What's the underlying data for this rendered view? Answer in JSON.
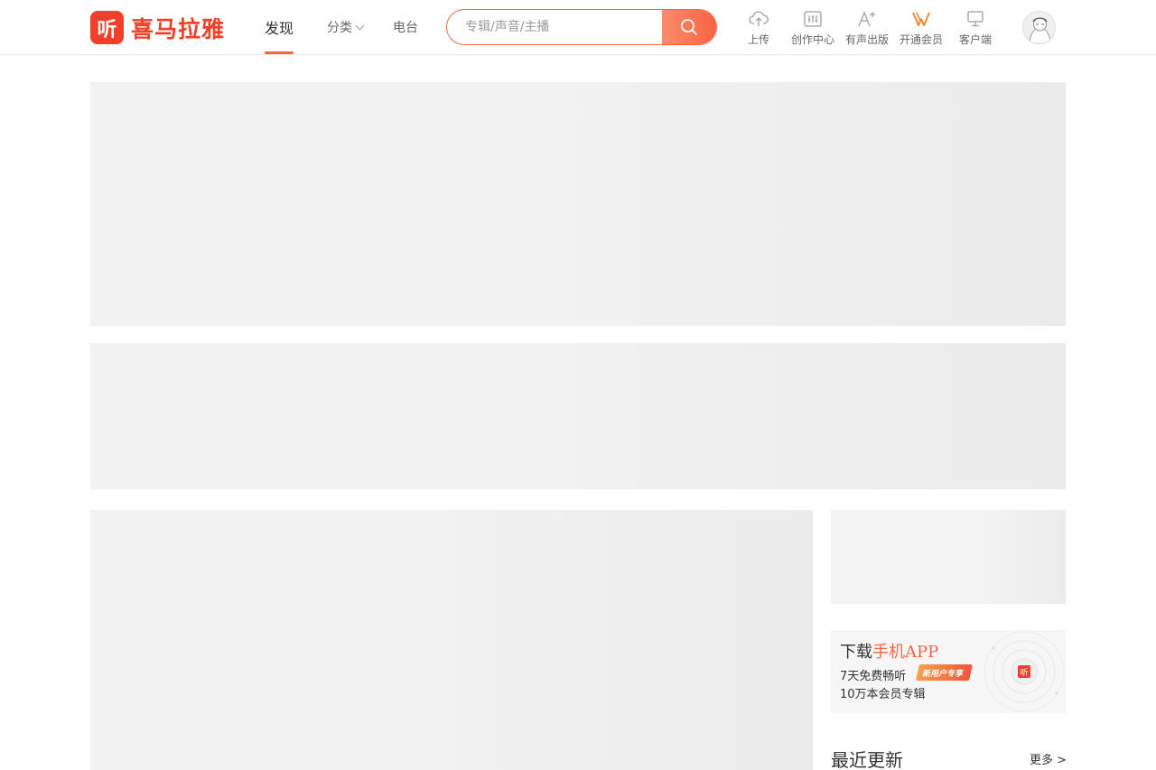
{
  "brand": {
    "logo_mark": "听",
    "name": "喜马拉雅",
    "color": "#f0402a",
    "accent": "#f86442"
  },
  "nav": {
    "discover": "发现",
    "category": "分类",
    "radio": "电台"
  },
  "search": {
    "placeholder": "专辑/声音/主播",
    "icon": "search-icon"
  },
  "tools": [
    {
      "label": "上传",
      "icon": "cloud-upload-icon"
    },
    {
      "label": "创作中心",
      "icon": "mixer-icon"
    },
    {
      "label": "有声出版",
      "icon": "font-plus-icon"
    },
    {
      "label": "开通会员",
      "icon": "vip-icon"
    },
    {
      "label": "客户端",
      "icon": "monitor-icon"
    }
  ],
  "app_card": {
    "title_prefix": "下载",
    "title_accent": "手机APP",
    "line1": "7天免费畅听",
    "line2": "10万本会员专辑",
    "badge": "新用户专享",
    "logo_mark": "听"
  },
  "recent": {
    "title": "最近更新",
    "more": "更多 >"
  }
}
